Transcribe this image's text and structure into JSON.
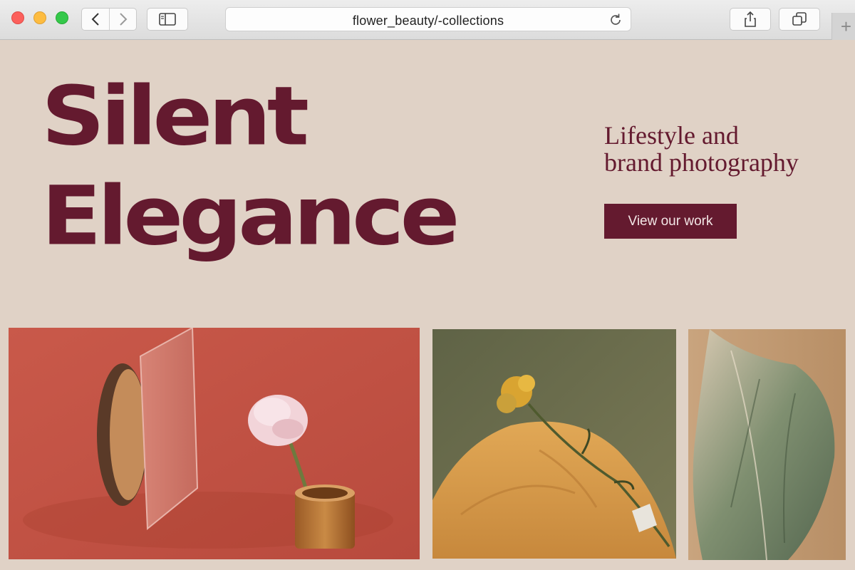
{
  "browser": {
    "url": "flower_beauty/-collections",
    "icons": {
      "back": "chevron-left-icon",
      "forward": "chevron-right-icon",
      "sidebar": "sidebar-icon",
      "reload": "reload-icon",
      "share": "share-icon",
      "tabs": "tabs-icon",
      "new_tab": "plus-icon"
    }
  },
  "hero": {
    "title_line1": "Silent",
    "title_line2": "Elegance",
    "tagline_line1": "Lifestyle and",
    "tagline_line2": "brand photography",
    "cta_label": "View our work"
  },
  "colors": {
    "page_background": "#e0d2c6",
    "brand": "#641a2f",
    "button_text": "#f3e6e6"
  },
  "gallery": {
    "items": [
      {
        "subject": "pink-rose-mirror-photo"
      },
      {
        "subject": "dried-yellow-flower-photo"
      },
      {
        "subject": "dried-leaf-photo"
      }
    ]
  }
}
